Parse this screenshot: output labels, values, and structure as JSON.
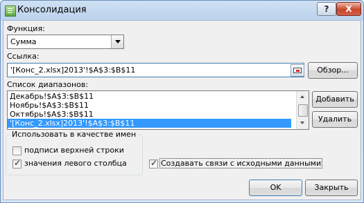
{
  "window": {
    "title": "Консолидация",
    "help_label": "?",
    "close_label": "X"
  },
  "function": {
    "label": "Функция:",
    "value": "Сумма"
  },
  "reference": {
    "label": "Ссылка:",
    "value": "'[Конс_2.xlsx]2013'!$A$3:$B$11",
    "browse_label": "Обзор..."
  },
  "ranges": {
    "label": "Список диапазонов:",
    "items": [
      "Декабрь!$A$3:$B$11",
      "Ноябрь!$A$3:$B$11",
      "Октябрь!$A$3:$B$11",
      "'[Конс_2.xlsx]2013'!$A$3:$B$11"
    ],
    "add_label": "Добавить",
    "delete_label": "Удалить"
  },
  "use_labels": {
    "title": "Использовать в качестве имен",
    "top_row": {
      "label": "подписи верхней строки",
      "checked": false
    },
    "left_column": {
      "label": "значения левого столбца",
      "checked": true
    }
  },
  "create_links": {
    "label": "Создавать связи с исходными данными",
    "checked": true
  },
  "ok_label": "OK",
  "close_label": "Закрыть"
}
